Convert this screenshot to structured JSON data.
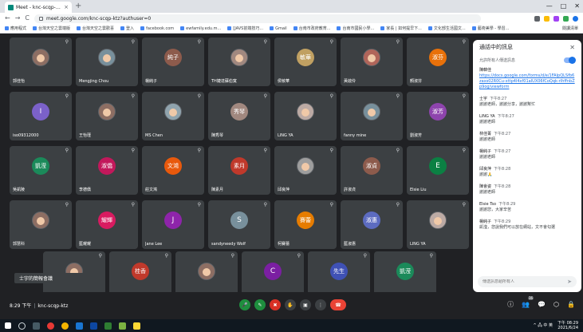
{
  "browser": {
    "tab_title": "Meet - knc-scqp-ktz",
    "tab_close": "×",
    "new_tab": "+",
    "window_controls": [
      "—",
      "□",
      "✕"
    ],
    "nav": {
      "back": "←",
      "forward": "→",
      "reload": "C"
    },
    "url": "meet.google.com/knc-scqp-ktz?authuser=0",
    "bookmarks": [
      "應用程式",
      "台灣天空之雲端版",
      "台灣天空之雲歡喜",
      "登入",
      "facebook.com",
      "ewfamily.edu.m...",
      "[JAVS前端技巧...",
      "Gmail",
      "台南市政府教育...",
      "台南市國民小學...",
      "家長 | 如何提早下...",
      "文化部生活國文...",
      "藝術美學 - 學習..."
    ],
    "bookmarks_right": "閱讀清單"
  },
  "tiles": [
    {
      "name": "郭佳怡",
      "avatar": "photo-icon",
      "bg": "#8d6e63"
    },
    {
      "name": "Mengjing Chou",
      "avatar": "photo-icon",
      "bg": "#78909c"
    },
    {
      "name": "楊純子",
      "initial": "純子",
      "bg": "#8d5b4c"
    },
    {
      "name": "TH婕達蘇伯寬",
      "avatar": "photo-icon",
      "bg": "#a1887f"
    },
    {
      "name": "侯敏華",
      "initial": "敏華",
      "bg": "#c0a062"
    },
    {
      "name": "黃啟伶",
      "avatar": "photo-icon",
      "bg": "#b0655a"
    },
    {
      "name": "顏淑芬",
      "initial": "淑芬",
      "bg": "#e8710a"
    },
    {
      "name": "iso09312000",
      "initial": "I",
      "bg": "#7b61c9"
    },
    {
      "name": "王怡瑾",
      "avatar": "photo-icon",
      "bg": "#8d6e63"
    },
    {
      "name": "MS Chen",
      "avatar": "photo-icon",
      "bg": "#90a4ae"
    },
    {
      "name": "陳秀琴",
      "initial": "秀琴",
      "bg": "#a1887f"
    },
    {
      "name": "LING YA",
      "avatar": "photo-icon",
      "bg": "#bcaaa4"
    },
    {
      "name": "fanny mine",
      "avatar": "photo-icon",
      "bg": "#78909c"
    },
    {
      "name": "劉淑芳",
      "initial": "淑芳",
      "bg": "#8e44ad"
    },
    {
      "name": "吳凱陵",
      "initial": "凱滢",
      "bg": "#1b8a5a"
    },
    {
      "name": "李德僑",
      "initial": "淑僑",
      "bg": "#c2185b"
    },
    {
      "name": "莊文鴻",
      "initial": "文鴻",
      "bg": "#e8590c"
    },
    {
      "name": "陳素月",
      "initial": "素月",
      "bg": "#c0392b"
    },
    {
      "name": "邱良萍",
      "avatar": "photo-icon",
      "bg": "#9e9e9e"
    },
    {
      "name": "許淑貞",
      "initial": "淑貞",
      "bg": "#8d5b4c"
    },
    {
      "name": "Elsie Liu",
      "initial": "E",
      "bg": "#0b8043"
    },
    {
      "name": "郭慧科",
      "avatar": "photo-icon",
      "bg": "#8d6e63"
    },
    {
      "name": "藍耀耀",
      "initial": "耀輝",
      "bg": "#d81b60"
    },
    {
      "name": "Jane Lee",
      "initial": "J",
      "bg": "#8e24aa"
    },
    {
      "name": "sandyneedy Wolf",
      "initial": "S",
      "bg": "#78909c"
    },
    {
      "name": "柯賽蕾",
      "initial": "賽蕾",
      "bg": "#e67c00"
    },
    {
      "name": "藍淑惠",
      "initial": "淑惠",
      "bg": "#5c6bc0"
    },
    {
      "name": "LING YA",
      "avatar": "photo-icon",
      "bg": "#bcaaa4"
    },
    {
      "name": "顏秀珊",
      "avatar": "photo-icon",
      "bg": "#8d6e63"
    },
    {
      "name": "譚桂香",
      "initial": "桂香",
      "bg": "#c0392b"
    },
    {
      "name": "呂瑞蓮",
      "avatar": "photo-icon",
      "bg": "#8d6e63"
    },
    {
      "name": "Chuchu Kuo",
      "initial": "C",
      "bg": "#7b1fa2"
    },
    {
      "name": "侯先生",
      "initial": "先生",
      "bg": "#3f51b5"
    },
    {
      "name": "你",
      "initial": "凱滢",
      "bg": "#1b8a5a"
    }
  ],
  "presenting_label": "士宇的簡報會議",
  "chat": {
    "title": "通話中的訊息",
    "toggle_label": "允許所有人傳送訊息",
    "messages": [
      {
        "who": "陳韓佳",
        "time": "",
        "body": "https://docs.google.com/forms/d/e/1FAIpQLSfb6zaxs02R0Cu-xttp4l4xf01aIUX06fCoQqk-rIhffnbZp9og/viewform",
        "link": true
      },
      {
        "who": "士宇",
        "time": "下午8:27",
        "body": "謝謝老師，謝謝分享，謝謝幫忙",
        "link": false
      },
      {
        "who": "LING YA",
        "time": "下午8:27",
        "body": "謝謝老師",
        "link": false
      },
      {
        "who": "林佳菁",
        "time": "下午8:27",
        "body": "謝謝老師",
        "link": false
      },
      {
        "who": "楊純子",
        "time": "下午8:27",
        "body": "謝謝老師",
        "link": false
      },
      {
        "who": "邱良萍",
        "time": "下午8:28",
        "body": "謝謝🙏",
        "link": false
      },
      {
        "who": "陳會姿",
        "time": "下午8:28",
        "body": "謝謝老師",
        "link": false
      },
      {
        "who": "Elsie Tso",
        "time": "下午8:29",
        "body": "謝謝您，大家辛苦",
        "link": false
      },
      {
        "who": "楊純子",
        "time": "下午8:29",
        "body": "凱滢，您說我們可以放在網站，文不會勾選",
        "link": false
      }
    ],
    "input_placeholder": "傳送訊息給所有人",
    "send_icon": "➤",
    "close_icon": "✕"
  },
  "bottom": {
    "time": "8:29 下午",
    "separator": "|",
    "meeting_code": "knc-scqp-ktz",
    "controls": [
      {
        "icon": "🎤",
        "name": "mic-button",
        "style": "green"
      },
      {
        "icon": "✎",
        "name": "captions-button",
        "style": "green"
      },
      {
        "icon": "✖",
        "name": "camera-off-button",
        "style": "red"
      },
      {
        "icon": "✋",
        "name": "raise-hand-button",
        "style": ""
      },
      {
        "icon": "▣",
        "name": "present-button",
        "style": ""
      },
      {
        "icon": "⋮",
        "name": "more-options-button",
        "style": ""
      },
      {
        "icon": "☎",
        "name": "end-call-button",
        "style": "end"
      }
    ],
    "right_controls": [
      {
        "icon": "ⓘ",
        "name": "meeting-details-button"
      },
      {
        "icon": "👥",
        "name": "people-button",
        "badge": "36"
      },
      {
        "icon": "💬",
        "name": "chat-button",
        "active": true
      },
      {
        "icon": "⬡",
        "name": "activities-button"
      },
      {
        "icon": "🔒",
        "name": "host-controls-button"
      }
    ]
  },
  "taskbar": {
    "tray": "^ 🖧 中 英",
    "clock_time": "下午 08:29",
    "clock_date": "2021/6/24"
  }
}
